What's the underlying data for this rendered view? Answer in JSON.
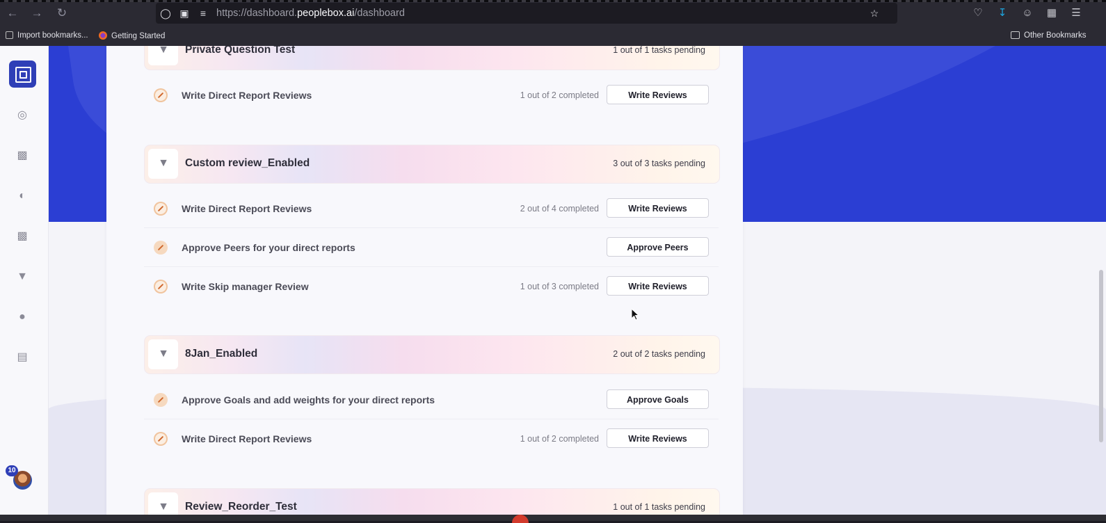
{
  "browser": {
    "url_prefix": "https://dashboard.",
    "url_domain": "peoplebox.ai",
    "url_path": "/dashboard",
    "bookmarks": [
      {
        "label": "Import bookmarks...",
        "icon": "import-icon"
      },
      {
        "label": "Getting Started",
        "icon": "firefox-icon"
      }
    ],
    "other_bookmarks": "Other Bookmarks"
  },
  "sidebar": {
    "icons": [
      "target-icon",
      "presentation-icon",
      "gauge-icon",
      "chat-icon",
      "trophy-icon",
      "message-icon",
      "bar-chart-icon"
    ],
    "notification_count": "10"
  },
  "cycles": [
    {
      "title": "Private Question Test",
      "pending": "1 out of 1 tasks pending",
      "tasks": [
        {
          "label": "Write Direct Report Reviews",
          "progress": "1 out of 2 completed",
          "button": "Write Reviews"
        }
      ]
    },
    {
      "title": "Custom review_Enabled",
      "pending": "3 out of 3 tasks pending",
      "tasks": [
        {
          "label": "Write Direct Report Reviews",
          "progress": "2 out of 4 completed",
          "button": "Write Reviews"
        },
        {
          "label": "Approve Peers for your direct reports",
          "progress": "",
          "button": "Approve Peers"
        },
        {
          "label": "Write Skip manager Review",
          "progress": "1 out of 3 completed",
          "button": "Write Reviews"
        }
      ]
    },
    {
      "title": "8Jan_Enabled",
      "pending": "2 out of 2 tasks pending",
      "tasks": [
        {
          "label": "Approve Goals and add weights for your direct reports",
          "progress": "",
          "button": "Approve Goals"
        },
        {
          "label": "Write Direct Report Reviews",
          "progress": "1 out of 2 completed",
          "button": "Write Reviews"
        }
      ]
    },
    {
      "title": "Review_Reorder_Test",
      "pending": "1 out of 1 tasks pending",
      "tasks": []
    }
  ],
  "colors": {
    "brand_blue": "#2b3ed3",
    "logo_blue": "#2f3fb7"
  }
}
